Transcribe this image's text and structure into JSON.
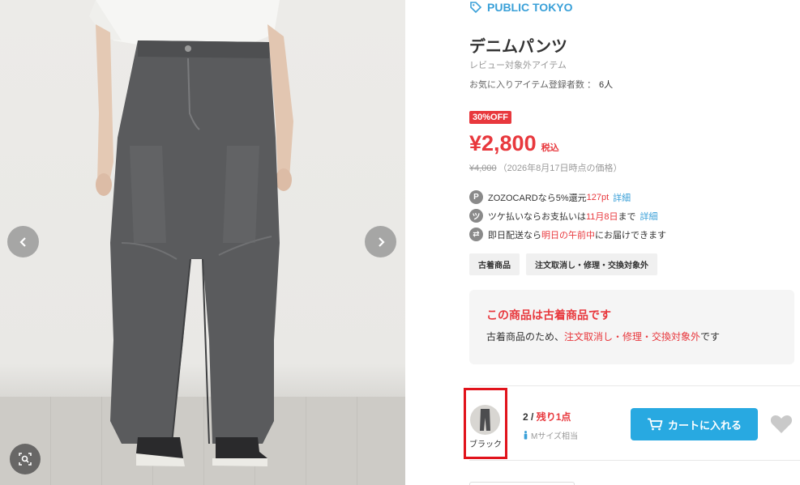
{
  "brand": {
    "name": "PUBLIC TOKYO",
    "icon": "tag-icon"
  },
  "product": {
    "title": "デニムパンツ",
    "review_note": "レビュー対象外アイテム",
    "favorites_label": "お気に入りアイテム登録者数 ：",
    "favorites_count": "6人"
  },
  "pricing": {
    "discount_badge": "30%OFF",
    "price": "¥2,800",
    "tax_label": "税込",
    "original_price": "¥4,000",
    "original_note": "（2026年8月17日時点の価格）"
  },
  "perks": [
    {
      "icon": "points-icon",
      "glyph": "P",
      "text_pre": "ZOZOCARDなら5%還元",
      "text_red": "127pt",
      "text_post": "",
      "link": "詳細"
    },
    {
      "icon": "deferred-pay-icon",
      "glyph": "ツ",
      "text_pre": "ツケ払いならお支払いは",
      "text_red": "11月8日",
      "text_post": "まで",
      "link": "詳細"
    },
    {
      "icon": "delivery-truck-icon",
      "glyph": "⇄",
      "text_pre": "即日配送なら",
      "text_red": "明日の午前中",
      "text_post": "にお届けできます",
      "link": ""
    }
  ],
  "tags": [
    "古着商品",
    "注文取消し・修理・交換対象外"
  ],
  "notice": {
    "title": "この商品は古着商品です",
    "body_pre": "古着商品のため、",
    "body_red": "注文取消し・修理・交換対象外",
    "body_post": "です"
  },
  "sku": {
    "color_name": "ブラック",
    "stock_prefix": "2 / ",
    "stock_left": "残り1点",
    "fit_note": "Mサイズ相当",
    "cart_button": "カートに入れる"
  },
  "colors": {
    "accent_blue": "#28a9e1",
    "sale_red": "#e8383d",
    "selection_border": "#e1131b"
  }
}
